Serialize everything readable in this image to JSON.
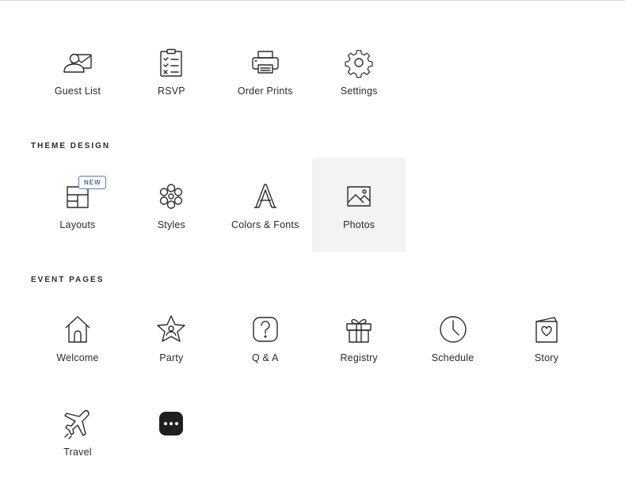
{
  "general": {
    "items": [
      {
        "label": "Guest List",
        "icon": "guest-list-icon"
      },
      {
        "label": "RSVP",
        "icon": "clipboard-checklist-icon"
      },
      {
        "label": "Order Prints",
        "icon": "printer-icon"
      },
      {
        "label": "Settings",
        "icon": "gear-icon"
      }
    ]
  },
  "theme_design": {
    "title": "THEME DESIGN",
    "items": [
      {
        "label": "Layouts",
        "icon": "layouts-icon",
        "badge": "NEW"
      },
      {
        "label": "Styles",
        "icon": "styles-flower-icon"
      },
      {
        "label": "Colors & Fonts",
        "icon": "letter-a-icon"
      },
      {
        "label": "Photos",
        "icon": "image-icon",
        "active": true
      }
    ]
  },
  "event_pages": {
    "title": "EVENT PAGES",
    "items": [
      {
        "label": "Welcome",
        "icon": "house-icon"
      },
      {
        "label": "Party",
        "icon": "star-person-icon"
      },
      {
        "label": "Q & A",
        "icon": "question-icon"
      },
      {
        "label": "Registry",
        "icon": "gift-icon"
      },
      {
        "label": "Schedule",
        "icon": "clock-icon"
      },
      {
        "label": "Story",
        "icon": "heart-card-icon"
      },
      {
        "label": "Travel",
        "icon": "airplane-icon"
      },
      {
        "label": "",
        "icon": "more-dots-icon"
      }
    ]
  },
  "colors": {
    "active_tile_bg": "#f3f3f3",
    "badge_accent": "#4a6f9c",
    "text": "#2b2b2b"
  }
}
